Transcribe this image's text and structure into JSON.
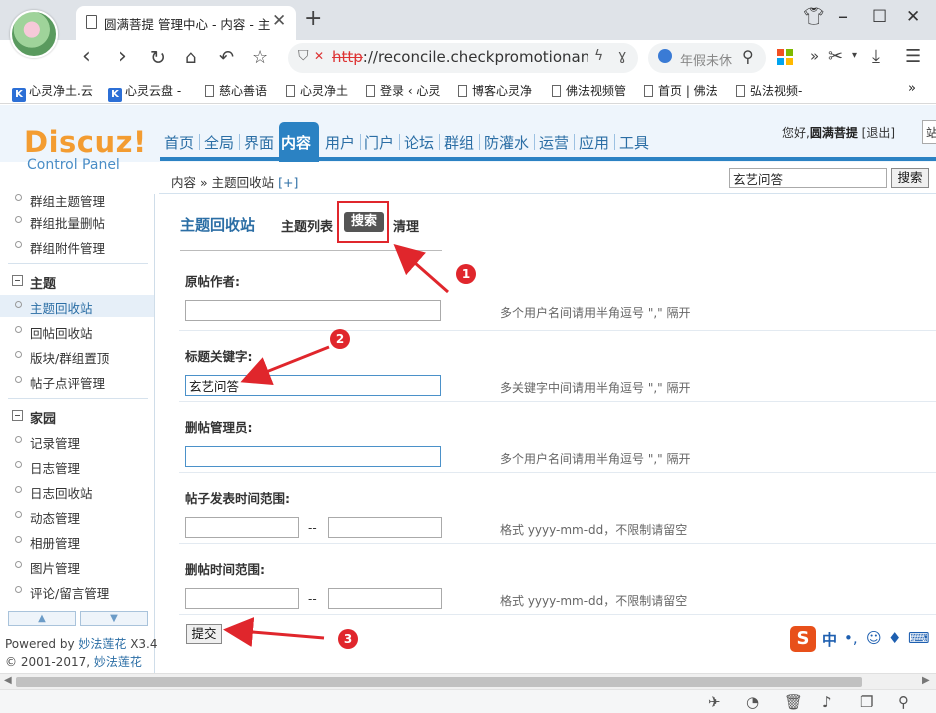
{
  "browser": {
    "tab_title": "圆满菩提 管理中心 - 内容 - 主",
    "tab_close": "✕",
    "new_tab": "+",
    "url_scheme": "http",
    "url_rest": "://reconcile.checkpromotionanph",
    "url_extra": "ɣ",
    "search_placeholder": "年假未休",
    "more": "»",
    "bookmarks": [
      {
        "label": "心灵净土.云",
        "icon": "k"
      },
      {
        "label": "心灵云盘 -",
        "icon": "k"
      },
      {
        "label": "慈心善语",
        "icon": "doc"
      },
      {
        "label": "心灵净土",
        "icon": "doc"
      },
      {
        "label": "登录 ‹ 心灵",
        "icon": "doc"
      },
      {
        "label": "博客心灵净",
        "icon": "doc"
      },
      {
        "label": "佛法视频管",
        "icon": "doc"
      },
      {
        "label": "首页 | 佛法",
        "icon": "doc"
      },
      {
        "label": "弘法视频-",
        "icon": "doc"
      }
    ],
    "bookmarks_more": "»"
  },
  "header": {
    "logo": "Discuz!",
    "logo_sub": "Control Panel",
    "nav": [
      "首页",
      "全局",
      "界面",
      "内容",
      "用户",
      "门户",
      "论坛",
      "群组",
      "防灌水",
      "运营",
      "应用",
      "工具"
    ],
    "active_nav": "内容",
    "greeting": "您好,",
    "username": "圆满菩提",
    "logout": "[退出]",
    "userbox_char": "站"
  },
  "breadcrumb": {
    "text": "内容 » 主题回收站",
    "add": "[+]",
    "search_value": "玄艺问答",
    "search_button": "搜索"
  },
  "sidebar": {
    "items": [
      {
        "type": "item",
        "label": "群组主题管理"
      },
      {
        "type": "item",
        "label": "群组批量删帖"
      },
      {
        "type": "item",
        "label": "群组附件管理"
      },
      {
        "type": "cat",
        "label": "主题"
      },
      {
        "type": "item",
        "label": "主题回收站",
        "active": true
      },
      {
        "type": "item",
        "label": "回帖回收站"
      },
      {
        "type": "item",
        "label": "版块/群组置顶"
      },
      {
        "type": "item",
        "label": "帖子点评管理"
      },
      {
        "type": "cat",
        "label": "家园"
      },
      {
        "type": "item",
        "label": "记录管理"
      },
      {
        "type": "item",
        "label": "日志管理"
      },
      {
        "type": "item",
        "label": "日志回收站"
      },
      {
        "type": "item",
        "label": "动态管理"
      },
      {
        "type": "item",
        "label": "相册管理"
      },
      {
        "type": "item",
        "label": "图片管理"
      },
      {
        "type": "item",
        "label": "评论/留言管理"
      }
    ],
    "powered_prefix": "Powered by ",
    "powered_link": "妙法莲花",
    "powered_version": " X3.4",
    "copyright_prefix": "© 2001-2017, ",
    "copyright_link": "妙法莲花"
  },
  "content": {
    "section_title": "主题回收站",
    "tabs": [
      "主题列表",
      "搜索",
      "清理"
    ],
    "active_tab": "搜索",
    "fields": [
      {
        "label": "原帖作者:",
        "value": "",
        "hint": "多个用户名间请用半角逗号 \",\" 隔开"
      },
      {
        "label": "标题关键字:",
        "value": "玄艺问答",
        "hint": "多关键字中间请用半角逗号 \",\" 隔开"
      },
      {
        "label": "删帖管理员:",
        "value": "",
        "hint": "多个用户名间请用半角逗号 \",\" 隔开"
      },
      {
        "label": "帖子发表时间范围:",
        "from": "",
        "to": "",
        "hint": "格式 yyyy-mm-dd，不限制请留空"
      },
      {
        "label": "删帖时间范围:",
        "from": "",
        "to": "",
        "hint": "格式 yyyy-mm-dd，不限制请留空"
      }
    ],
    "range_sep": "--",
    "submit": "提交"
  },
  "annotations": [
    "1",
    "2",
    "3"
  ],
  "ime": {
    "logo": "S",
    "mode": "中"
  },
  "colors": {
    "accent": "#2b82c3",
    "logo": "#f39c31",
    "annotation": "#e0262c",
    "link": "#2b6ea5"
  }
}
